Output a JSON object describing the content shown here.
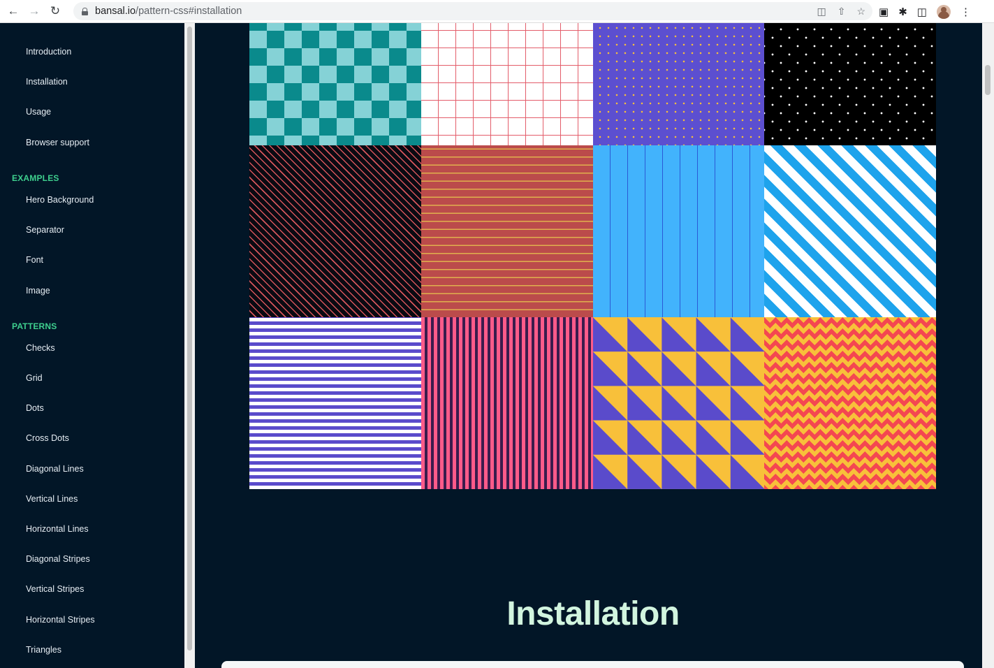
{
  "browser": {
    "url_host": "bansal.io",
    "url_path": "/pattern-css#installation"
  },
  "sidebar": {
    "top_items": [
      {
        "label": "Introduction"
      },
      {
        "label": "Installation"
      },
      {
        "label": "Usage"
      },
      {
        "label": "Browser support"
      }
    ],
    "examples_heading": "EXAMPLES",
    "examples_items": [
      {
        "label": "Hero Background"
      },
      {
        "label": "Separator"
      },
      {
        "label": "Font"
      },
      {
        "label": "Image"
      }
    ],
    "patterns_heading": "PATTERNS",
    "patterns_items": [
      {
        "label": "Checks"
      },
      {
        "label": "Grid"
      },
      {
        "label": "Dots"
      },
      {
        "label": "Cross Dots"
      },
      {
        "label": "Diagonal Lines"
      },
      {
        "label": "Vertical Lines"
      },
      {
        "label": "Horizontal Lines"
      },
      {
        "label": "Diagonal Stripes"
      },
      {
        "label": "Vertical Stripes"
      },
      {
        "label": "Horizontal Stripes"
      },
      {
        "label": "Triangles"
      }
    ]
  },
  "main": {
    "section_title": "Installation",
    "pattern_tiles": [
      {
        "pattern": "checks",
        "colors": [
          "#85d2d6",
          "#0a8a8c"
        ]
      },
      {
        "pattern": "grid",
        "colors": [
          "#ffffff",
          "#e35d6a"
        ]
      },
      {
        "pattern": "dots",
        "colors": [
          "#5c4fd0",
          "#f7bf3b"
        ]
      },
      {
        "pattern": "cross-dots",
        "colors": [
          "#000000",
          "#ffffff"
        ]
      },
      {
        "pattern": "diagonal-lines",
        "colors": [
          "#0a0a12",
          "#d5555b"
        ]
      },
      {
        "pattern": "horizontal-lines",
        "colors": [
          "#bb4b4b",
          "#e0b04d"
        ]
      },
      {
        "pattern": "vertical-lines",
        "colors": [
          "#42b3fc",
          "#2b5ad6"
        ]
      },
      {
        "pattern": "diagonal-stripes",
        "colors": [
          "#ffffff",
          "#1ea3ec"
        ]
      },
      {
        "pattern": "horizontal-stripes",
        "colors": [
          "#ffffff",
          "#5a4bcb"
        ]
      },
      {
        "pattern": "vertical-stripes",
        "colors": [
          "#ff5b8a",
          "#3b1c4d"
        ]
      },
      {
        "pattern": "triangles",
        "colors": [
          "#f8c03a",
          "#5a4bcb"
        ]
      },
      {
        "pattern": "zigzag",
        "colors": [
          "#f44751",
          "#f8c03a"
        ]
      }
    ]
  },
  "theme": {
    "background": "#021627",
    "accent": "#3ecf8e",
    "title_color": "#d2f5df"
  }
}
